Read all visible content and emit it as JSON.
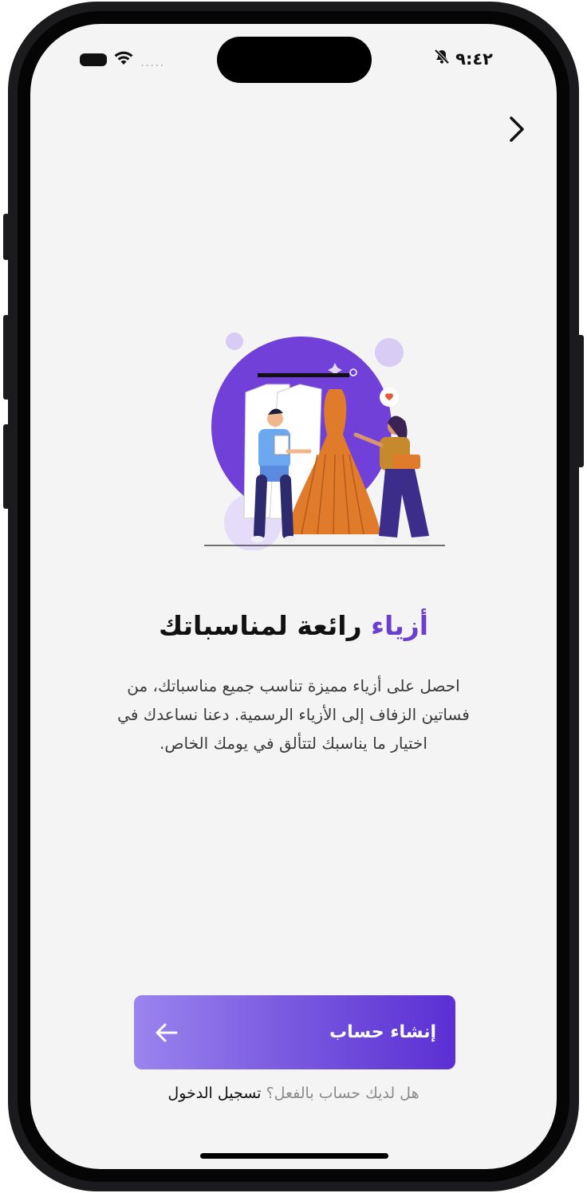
{
  "status_bar": {
    "time": "٩:٤٢",
    "signal_dots": "....."
  },
  "onboarding": {
    "title_accent": "أزياء",
    "title_rest": "رائعة لمناسباتك",
    "description": "احصل على أزياء مميزة تناسب جميع مناسباتك، من فساتين الزفاف إلى الأزياء الرسمية. دعنا نساعدك في اختيار ما يناسبك لتتألق في يومك الخاص."
  },
  "cta": {
    "label": "إنشاء حساب"
  },
  "login": {
    "question": "هل لديك حساب بالفعل؟",
    "link": "تسجيل الدخول"
  },
  "colors": {
    "accent": "#6a3fd0",
    "button_start": "#9a84ee",
    "button_end": "#5b2fd3",
    "background": "#f4f4f4"
  },
  "icons": {
    "back": "chevron-right-icon",
    "cta_arrow": "arrow-left-icon",
    "battery": "battery-icon",
    "wifi": "wifi-icon",
    "silent": "bell-slash-icon"
  }
}
